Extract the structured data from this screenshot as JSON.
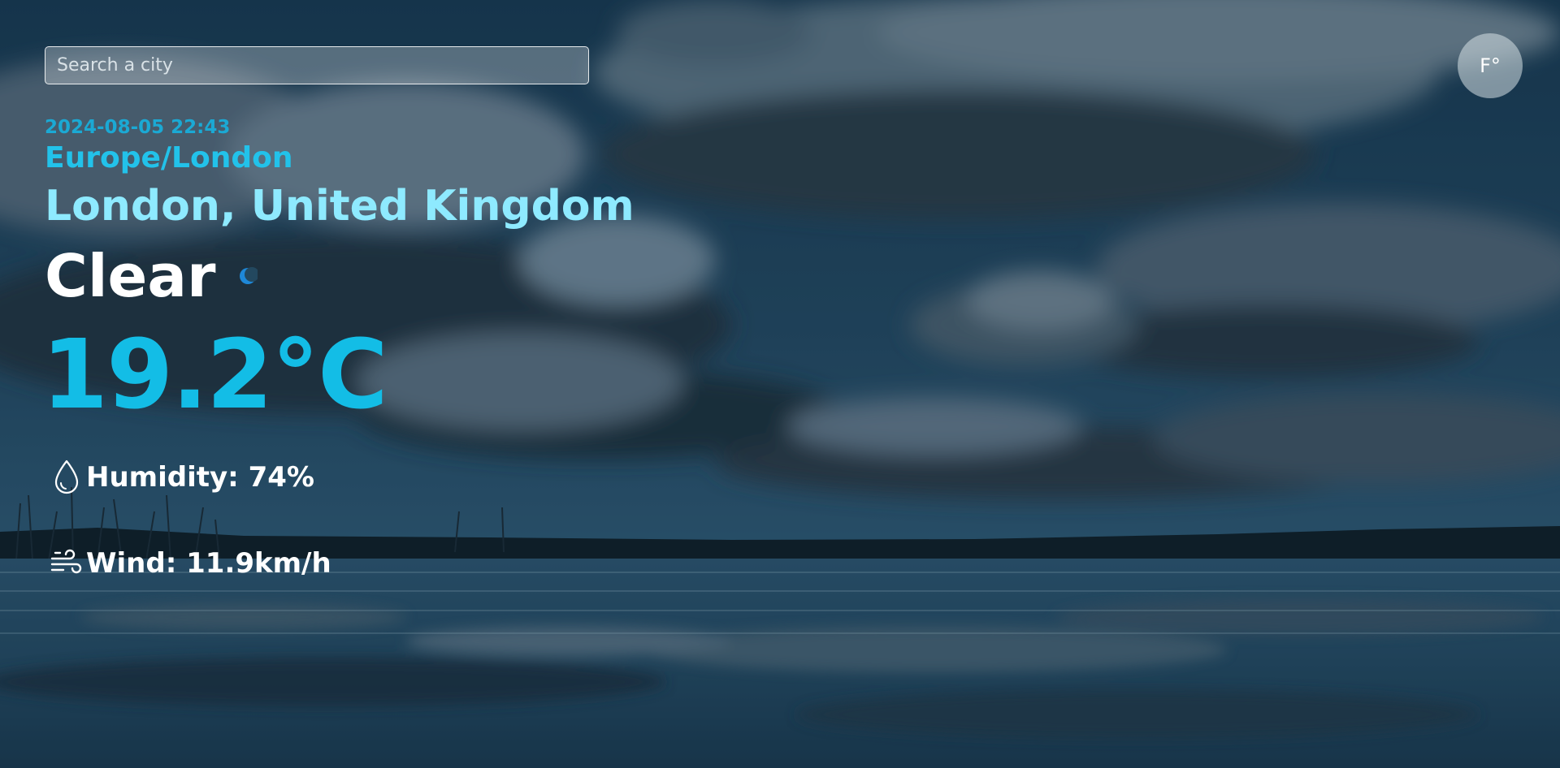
{
  "search": {
    "placeholder": "Search a city",
    "value": ""
  },
  "unit_toggle": {
    "label": "F°"
  },
  "weather": {
    "datetime": "2024-08-05 22:43",
    "timezone": "Europe/London",
    "location": "London, United Kingdom",
    "condition": "Clear",
    "condition_icon": "moon-icon",
    "temperature": "19.2°C",
    "humidity_label": "Humidity: 74%",
    "humidity_icon": "water-drop-icon",
    "wind_label": "Wind: 11.9km/h",
    "wind_icon": "wind-icon"
  },
  "colors": {
    "accent": "#13bde6",
    "timezone": "#22c2ea",
    "location": "#8eeaff",
    "datetime": "#1ba9d4",
    "text": "#ffffff"
  }
}
